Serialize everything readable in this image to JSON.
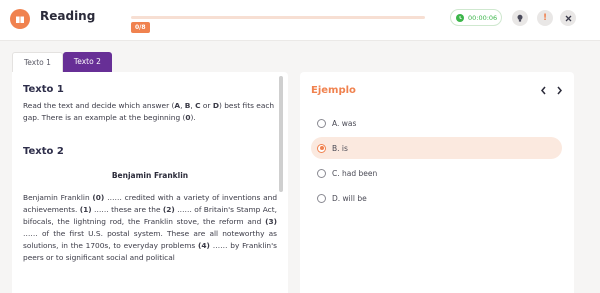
{
  "header": {
    "title": "Reading",
    "progress_label": "0/8",
    "progress_fraction": 0,
    "timer": "00:00:06"
  },
  "tabs": [
    {
      "label": "Texto 1",
      "active": false
    },
    {
      "label": "Texto 2",
      "active": true
    }
  ],
  "left": {
    "section1_title": "Texto 1",
    "instructions_prefix": "Read the text and decide which answer (",
    "letter_a": "A",
    "sep1": ", ",
    "letter_b": "B",
    "sep2": ", ",
    "letter_c": "C",
    "or": " or ",
    "letter_d": "D",
    "instructions_mid": ") best fits each gap. There is an example at the beginning (",
    "letter_zero": "0",
    "instructions_end": ").",
    "section2_title": "Texto 2",
    "article_title": "Benjamin Franklin",
    "body": [
      {
        "text": "Benjamin Franklin ",
        "bold": false
      },
      {
        "text": "(0)",
        "bold": true
      },
      {
        "text": " …… credited with a variety of inventions and achievements. ",
        "bold": false
      },
      {
        "text": "(1)",
        "bold": true
      },
      {
        "text": " …… these are the ",
        "bold": false
      },
      {
        "text": "(2)",
        "bold": true
      },
      {
        "text": " …… of Britain's Stamp Act, bifocals, the lightning rod, the Franklin stove, the reform and ",
        "bold": false
      },
      {
        "text": "(3)",
        "bold": true
      },
      {
        "text": " …… of the first U.S. postal system. These are all noteworthy as solutions, in the 1700s, to everyday problems ",
        "bold": false
      },
      {
        "text": "(4)",
        "bold": true
      },
      {
        "text": " …… by Franklin's peers or to significant social and political",
        "bold": false
      }
    ]
  },
  "right": {
    "title": "Ejemplo",
    "options": [
      {
        "label": "A. was",
        "selected": false
      },
      {
        "label": "B. is",
        "selected": true
      },
      {
        "label": "C. had been",
        "selected": false
      },
      {
        "label": "D. will be",
        "selected": false
      }
    ]
  },
  "colors": {
    "accent": "#f0824f",
    "tab_active": "#672f96",
    "timer": "#3cb64a"
  },
  "icons": [
    "book-icon",
    "clock-icon",
    "bulb-icon",
    "alert-icon",
    "close-icon",
    "chevron-left-icon",
    "chevron-right-icon"
  ]
}
